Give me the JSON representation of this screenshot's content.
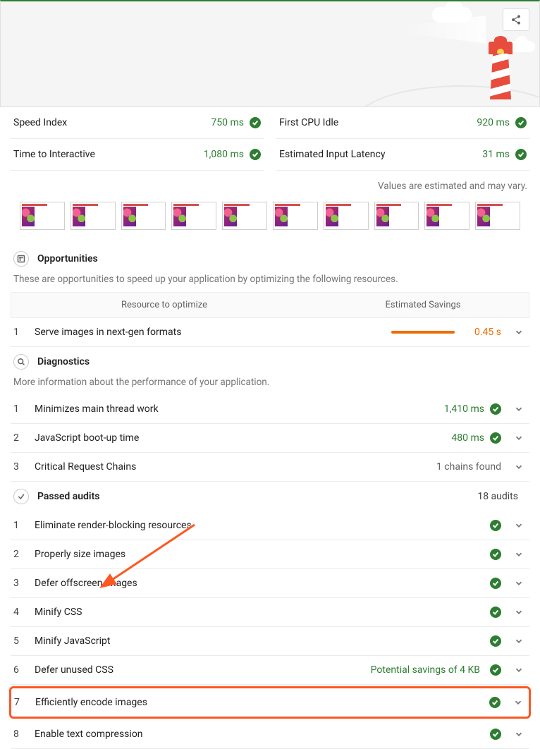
{
  "metrics": {
    "left": [
      {
        "label": "Speed Index",
        "value": "750 ms"
      },
      {
        "label": "Time to Interactive",
        "value": "1,080 ms"
      }
    ],
    "right": [
      {
        "label": "First CPU Idle",
        "value": "920 ms"
      },
      {
        "label": "Estimated Input Latency",
        "value": "31 ms"
      }
    ]
  },
  "estimate_note": "Values are estimated and may vary.",
  "opportunities": {
    "title": "Opportunities",
    "desc": "These are opportunities to speed up your application by optimizing the following resources.",
    "col1": "Resource to optimize",
    "col2": "Estimated Savings",
    "items": [
      {
        "n": "1",
        "label": "Serve images in next-gen formats",
        "savings": "0.45 s"
      }
    ]
  },
  "diagnostics": {
    "title": "Diagnostics",
    "desc": "More information about the performance of your application.",
    "items": [
      {
        "n": "1",
        "label": "Minimizes main thread work",
        "value": "1,410 ms",
        "pass": true
      },
      {
        "n": "2",
        "label": "JavaScript boot-up time",
        "value": "480 ms",
        "pass": true
      },
      {
        "n": "3",
        "label": "Critical Request Chains",
        "text": "1 chains found"
      }
    ]
  },
  "passed": {
    "title": "Passed audits",
    "count": "18 audits",
    "items": [
      {
        "n": "1",
        "label": "Eliminate render-blocking resources"
      },
      {
        "n": "2",
        "label": "Properly size images"
      },
      {
        "n": "3",
        "label": "Defer offscreen images"
      },
      {
        "n": "4",
        "label": "Minify CSS"
      },
      {
        "n": "5",
        "label": "Minify JavaScript"
      },
      {
        "n": "6",
        "label": "Defer unused CSS",
        "value": "Potential savings of 4 KB"
      },
      {
        "n": "7",
        "label": "Efficiently encode images",
        "highlight": true
      },
      {
        "n": "8",
        "label": "Enable text compression"
      }
    ]
  }
}
